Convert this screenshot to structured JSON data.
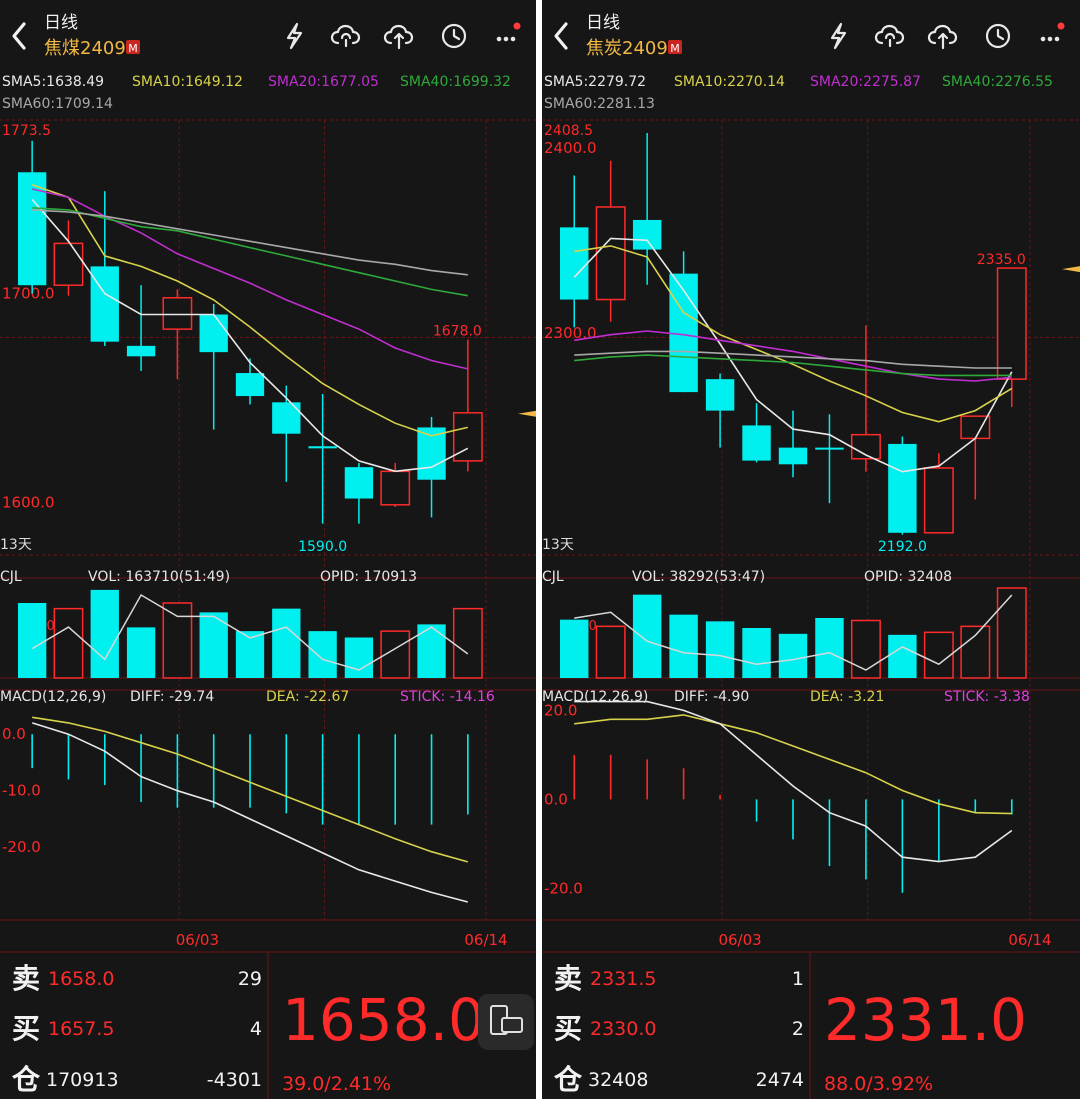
{
  "colors": {
    "cyan": "#00f0f0",
    "red": "#ff2a2a",
    "gold": "#f2b844",
    "white_line": "#e8e8e8",
    "yellow_line": "#d8d24a",
    "magenta_line": "#c02ed0",
    "green_line": "#2fa93a",
    "gray_line": "#a8a8a8",
    "grid": "#6a1414",
    "bg": "#161616"
  },
  "panels": [
    {
      "id": "left",
      "header": {
        "back_icon": "chevron-left-icon",
        "period": "日线",
        "symbol": "焦煤2409",
        "badge": "M"
      },
      "toolbar_icons": [
        "lightning-icon",
        "cloud-sync-icon",
        "cloud-upload-icon",
        "clock-icon",
        "more-icon"
      ],
      "sma_labels": [
        "SMA5:1638.49",
        "SMA10:1649.12",
        "SMA20:1677.05",
        "SMA40:1699.32",
        "SMA60:1709.14"
      ],
      "price_axis": {
        "max": 1783,
        "min": 1575,
        "labels": [
          {
            "v": 1700,
            "text": "1700.0"
          },
          {
            "v": 1600,
            "text": "1600.0"
          }
        ]
      },
      "peak_label": "1773.5",
      "high_label": "1678.0",
      "low_label": "1590.0",
      "days_label": "13天",
      "candles": [
        {
          "o": 1758,
          "h": 1773,
          "l": 1700,
          "c": 1704
        },
        {
          "o": 1704,
          "h": 1735,
          "l": 1699,
          "c": 1724
        },
        {
          "o": 1713,
          "h": 1749,
          "l": 1675,
          "c": 1677
        },
        {
          "o": 1675,
          "h": 1704,
          "l": 1663,
          "c": 1670
        },
        {
          "o": 1683,
          "h": 1702,
          "l": 1659,
          "c": 1698
        },
        {
          "o": 1690,
          "h": 1695,
          "l": 1635,
          "c": 1672
        },
        {
          "o": 1662,
          "h": 1669,
          "l": 1647,
          "c": 1651
        },
        {
          "o": 1648,
          "h": 1656,
          "l": 1610,
          "c": 1633
        },
        {
          "o": 1627,
          "h": 1652,
          "l": 1590,
          "c": 1626
        },
        {
          "o": 1617,
          "h": 1619,
          "l": 1590,
          "c": 1602
        },
        {
          "o": 1599,
          "h": 1619,
          "l": 1598,
          "c": 1615
        },
        {
          "o": 1636,
          "h": 1641,
          "l": 1593,
          "c": 1611
        },
        {
          "o": 1620,
          "h": 1678,
          "l": 1615,
          "c": 1643
        }
      ],
      "sma_lines": [
        {
          "name": "SMA5",
          "color": "white_line",
          "values": [
            1745,
            1725,
            1700,
            1690,
            1690,
            1690,
            1667,
            1650,
            1632,
            1620,
            1615,
            1617,
            1626
          ]
        },
        {
          "name": "SMA10",
          "color": "yellow_line",
          "values": [
            1752,
            1746,
            1718,
            1713,
            1706,
            1697,
            1684,
            1670,
            1657,
            1647,
            1638,
            1632,
            1636
          ]
        },
        {
          "name": "SMA20",
          "color": "magenta_line",
          "values": [
            1750,
            1746,
            1737,
            1729,
            1719,
            1712,
            1705,
            1697,
            1690,
            1683,
            1674,
            1668,
            1664
          ]
        },
        {
          "name": "SMA40",
          "color": "green_line",
          "values": [
            1741,
            1740,
            1736,
            1732,
            1730,
            1726,
            1722,
            1718,
            1714,
            1710,
            1706,
            1702,
            1699
          ]
        },
        {
          "name": "SMA60",
          "color": "gray_line",
          "values": [
            1740,
            1739,
            1737,
            1734,
            1731,
            1728,
            1725,
            1722,
            1719,
            1716,
            1714,
            1711,
            1709
          ]
        }
      ],
      "volume": {
        "label": "CJL",
        "vol_text": "VOL: 163710(51:49)",
        "opid_text": "OPID: 170913",
        "axis_label": "300.1",
        "max": 240000,
        "bars": [
          200000,
          185000,
          235000,
          135000,
          200000,
          175000,
          125000,
          185000,
          125000,
          108000,
          125000,
          143000,
          185000
        ],
        "opid_line": [
          172000,
          176000,
          170000,
          182000,
          178000,
          178000,
          174000,
          176000,
          170000,
          168000,
          172000,
          176000,
          171000
        ]
      },
      "macd": {
        "label": "MACD(12,26,9)",
        "diff_text": "DIFF: -29.74",
        "dea_text": "DEA: -22.67",
        "stick_text": "STICK: -14.16",
        "axis": {
          "max": 5,
          "min": -32,
          "labels": [
            {
              "v": 0,
              "text": "0.0"
            },
            {
              "v": -10,
              "text": "-10.0"
            },
            {
              "v": -20,
              "text": "-20.0"
            }
          ]
        },
        "diff": [
          2,
          0,
          -3,
          -7.5,
          -10,
          -12,
          -15,
          -18,
          -21,
          -24,
          -26,
          -28,
          -29.7
        ],
        "dea": [
          3,
          2,
          0.5,
          -1.5,
          -3.5,
          -6,
          -8.5,
          -11,
          -13.5,
          -16,
          -18.5,
          -20.8,
          -22.6
        ],
        "stick": [
          -6,
          -8,
          -9,
          -12,
          -13,
          -13,
          -13,
          -14,
          -16,
          -16,
          -16,
          -16,
          -14.2
        ]
      },
      "dates": [
        "06/03",
        "06/14"
      ],
      "order_book": {
        "sell_label": "卖",
        "sell_price": "1658.0",
        "sell_qty": "29",
        "buy_label": "买",
        "buy_price": "1657.5",
        "buy_qty": "4",
        "pos_label": "仓",
        "pos_value": "170913",
        "pos_change": "-4301",
        "last_price": "1658.0",
        "change": "39.0/2.41%"
      },
      "device_icon": "device-toggle-icon"
    },
    {
      "id": "right",
      "header": {
        "back_icon": "chevron-left-icon",
        "period": "日线",
        "symbol": "焦炭2409",
        "badge": "M"
      },
      "toolbar_icons": [
        "lightning-icon",
        "cloud-sync-icon",
        "cloud-upload-icon",
        "clock-icon",
        "more-icon"
      ],
      "sma_labels": [
        "SMA5:2279.72",
        "SMA10:2270.14",
        "SMA20:2275.87",
        "SMA40:2276.55",
        "SMA60:2281.13"
      ],
      "price_axis": {
        "max": 2415,
        "min": 2180,
        "labels": [
          {
            "v": 2400,
            "text": "2400.0"
          },
          {
            "v": 2300,
            "text": "2300.0"
          }
        ]
      },
      "peak_label": "2408.5",
      "high_label": "2335.0",
      "low_label": "2192.0",
      "days_label": "13天",
      "candles": [
        {
          "o": 2357,
          "h": 2385,
          "l": 2303,
          "c": 2318
        },
        {
          "o": 2318,
          "h": 2393,
          "l": 2306,
          "c": 2368
        },
        {
          "o": 2361,
          "h": 2408,
          "l": 2326,
          "c": 2345
        },
        {
          "o": 2332,
          "h": 2344,
          "l": 2268,
          "c": 2268
        },
        {
          "o": 2275,
          "h": 2278,
          "l": 2238,
          "c": 2258
        },
        {
          "o": 2250,
          "h": 2262,
          "l": 2230,
          "c": 2231
        },
        {
          "o": 2238,
          "h": 2258,
          "l": 2222,
          "c": 2229
        },
        {
          "o": 2238,
          "h": 2256,
          "l": 2208,
          "c": 2237
        },
        {
          "o": 2232,
          "h": 2304,
          "l": 2225,
          "c": 2245
        },
        {
          "o": 2240,
          "h": 2244,
          "l": 2191,
          "c": 2192
        },
        {
          "o": 2192,
          "h": 2235,
          "l": 2192,
          "c": 2227
        },
        {
          "o": 2243,
          "h": 2254,
          "l": 2210,
          "c": 2255
        },
        {
          "o": 2275,
          "h": 2335,
          "l": 2260,
          "c": 2335
        }
      ],
      "sma_lines": [
        {
          "name": "SMA5",
          "color": "white_line",
          "values": [
            2330,
            2351,
            2350,
            2323,
            2294,
            2264,
            2248,
            2245,
            2234,
            2225,
            2228,
            2243,
            2279
          ]
        },
        {
          "name": "SMA10",
          "color": "yellow_line",
          "values": [
            2344,
            2347,
            2341,
            2311,
            2299,
            2291,
            2283,
            2274,
            2266,
            2257,
            2252,
            2258,
            2270
          ]
        },
        {
          "name": "SMA20",
          "color": "magenta_line",
          "values": [
            2296,
            2299,
            2301,
            2299,
            2296,
            2293,
            2290,
            2286,
            2282,
            2278,
            2275,
            2274,
            2276
          ]
        },
        {
          "name": "SMA40",
          "color": "green_line",
          "values": [
            2285,
            2287,
            2288,
            2287,
            2286,
            2285,
            2284,
            2282,
            2280,
            2278,
            2277,
            2277,
            2277
          ]
        },
        {
          "name": "SMA60",
          "color": "gray_line",
          "values": [
            2288,
            2289,
            2290,
            2290,
            2289,
            2288,
            2287,
            2286,
            2285,
            2283,
            2282,
            2281,
            2281
          ]
        }
      ],
      "volume": {
        "label": "CJL",
        "vol_text": "VOL: 38292(53:47)",
        "opid_text": "OPID: 32408",
        "axis_label": "200",
        "max": 54000,
        "bars": [
          35000,
          31000,
          50000,
          38000,
          34000,
          30000,
          26500,
          36000,
          34500,
          25900,
          27400,
          31000,
          54000
        ],
        "opid_line": [
          30000,
          31000,
          26000,
          24000,
          23500,
          22000,
          22800,
          24000,
          21000,
          25000,
          22000,
          27000,
          34000
        ]
      },
      "macd": {
        "label": "MACD(12,26,9)",
        "diff_text": "DIFF: -4.90",
        "dea_text": "DEA: -3.21",
        "stick_text": "STICK: -3.38",
        "axis": {
          "max": 21,
          "min": -26,
          "labels": [
            {
              "v": 20,
              "text": "20.0"
            },
            {
              "v": 0,
              "text": "0.0"
            },
            {
              "v": -20,
              "text": "-20.0"
            }
          ]
        },
        "diff": [
          22,
          22,
          22,
          20,
          17,
          10,
          3,
          -3,
          -6,
          -13,
          -14,
          -13,
          -7
        ],
        "dea": [
          17,
          18,
          18,
          19,
          17,
          15,
          12,
          9,
          6,
          2,
          -1,
          -3,
          -3.2
        ],
        "stick": [
          10,
          10,
          9,
          7,
          1,
          -5,
          -9,
          -15,
          -18,
          -21,
          -14,
          -3,
          -3.4
        ]
      },
      "dates": [
        "06/03",
        "06/14"
      ],
      "order_book": {
        "sell_label": "卖",
        "sell_price": "2331.5",
        "sell_qty": "1",
        "buy_label": "买",
        "buy_price": "2330.0",
        "buy_qty": "2",
        "pos_label": "仓",
        "pos_value": "32408",
        "pos_change": "2474",
        "last_price": "2331.0",
        "change": "88.0/3.92%"
      },
      "device_icon": null
    }
  ]
}
